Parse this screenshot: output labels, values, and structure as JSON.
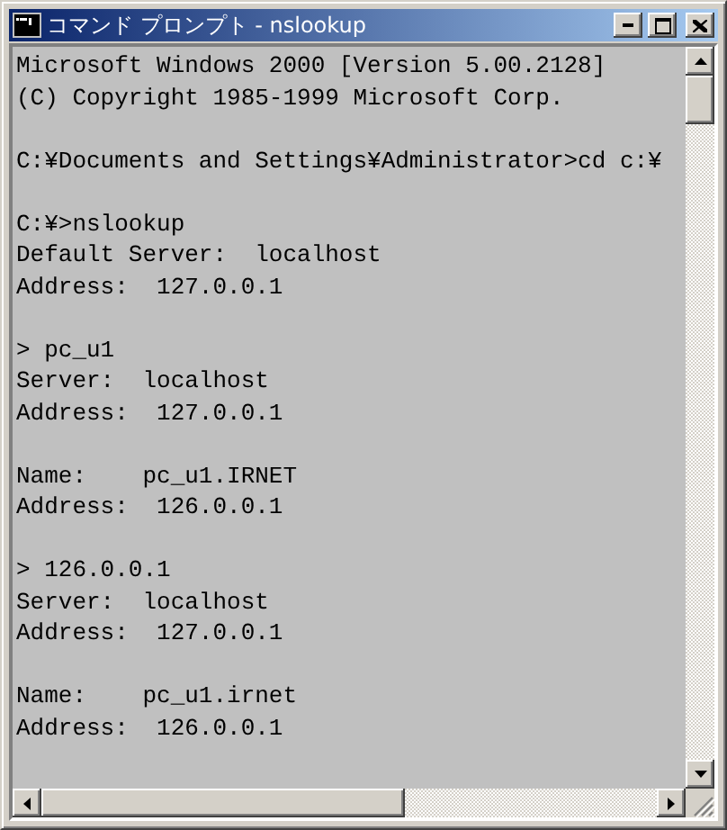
{
  "window": {
    "title": "コマンド プロンプト - nslookup"
  },
  "console": {
    "blocks": [
      [
        "Microsoft Windows 2000 [Version 5.00.2128]",
        "(C) Copyright 1985-1999 Microsoft Corp."
      ],
      [
        "C:¥Documents and Settings¥Administrator>cd c:¥"
      ],
      [
        "C:¥>nslookup",
        "Default Server:  localhost",
        "Address:  127.0.0.1"
      ],
      [
        "> pc_u1",
        "Server:  localhost",
        "Address:  127.0.0.1"
      ],
      [
        "Name:    pc_u1.IRNET",
        "Address:  126.0.0.1"
      ],
      [
        "> 126.0.0.1",
        "Server:  localhost",
        "Address:  127.0.0.1"
      ],
      [
        "Name:    pc_u1.irnet",
        "Address:  126.0.0.1"
      ]
    ]
  }
}
